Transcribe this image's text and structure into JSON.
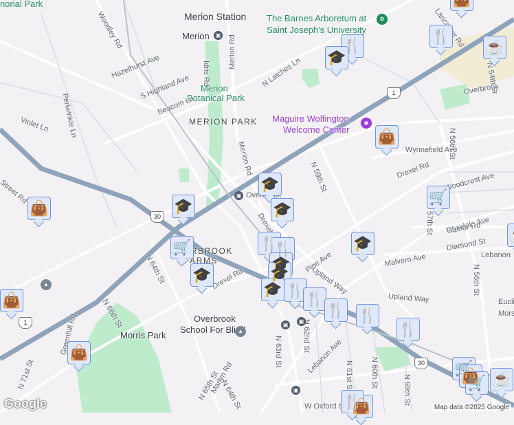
{
  "labels": {
    "merion_station": "Merion Station",
    "barnes_1": "The Barnes Arboretum at",
    "barnes_2": "Saint Joseph's University",
    "merion": "Merion",
    "woodley": "Woodley Rd",
    "merion_rd": "Merion Rd",
    "idris": "Idris Rd",
    "hazelhurst": "Hazelhurst Ave",
    "latches": "N Latches Ln",
    "highland": "S Highland Ave",
    "botanical_1": "Merion",
    "botanical_2": "Botanical Park",
    "periwinkle": "Periwinkle Ln",
    "beacom": "Beacom Ln",
    "merion_park": "MERION PARK",
    "maguire_1": "Maguire Wolfington",
    "maguire_2": "Welcome Center",
    "violet": "Violet Ln",
    "merion_rd2": "Merion Rd",
    "n59": "N 59th St",
    "wynnefield": "Wynnefield Ave",
    "drexel_ne": "Drexel Rd",
    "overbrook_stn": "Overbrook",
    "woodcrest": "Woodcrest Ave",
    "wyndale": "Wyndale Ave",
    "gainor": "Gainor Rd",
    "diamond": "Diamond St",
    "malvern": "Malvern Ave",
    "lebanon_e": "Lebanon",
    "n57": "N 57th St",
    "pine": "Pine Ave",
    "upland1": "Upland Way",
    "upland2": "Upland Way",
    "drexel_w": "Drexel Rd",
    "drexel_c": "Drexel Rd",
    "n64": "N 64th St",
    "farms_1": "OVERBROOK",
    "farms_2": "FARMS",
    "n66": "N 66th St",
    "morris": "Morris Park",
    "school_1": "Overbrook",
    "school_2": "School For Blind",
    "n63": "N 63rd St",
    "n62": "N 62nd St",
    "lebanon": "Lebanon Ave",
    "n61": "N 61st St",
    "n60": "N 60th St",
    "n59s": "N 59th St",
    "oxford": "W Oxford St",
    "greenhill": "Greenhill Rd",
    "n71": "N 71st St",
    "n64s": "N 64th St",
    "marlyn": "Marlyn Rd",
    "n65": "N 65th St",
    "overbrook_ne": "Overbrook",
    "lancaster": "Lancaster Rd",
    "n54": "N 54th St",
    "n56": "N 56th St",
    "n56b": "N 56th St",
    "euclid": "Euclid",
    "morse": "Morse",
    "street_rd": "Street Rd",
    "norial": "norial Park"
  },
  "shields": {
    "us1": "1",
    "us30": "30"
  },
  "credit": "Map data ©2025 Google",
  "logo": "Google",
  "colors": {
    "marker_bg": "#dfe8fb",
    "marker_border": "#7193db",
    "icon": "#0e4a6c",
    "park": "#1e8c5a",
    "poi": "#9a3bd8",
    "highway": "#8fa4bb"
  }
}
